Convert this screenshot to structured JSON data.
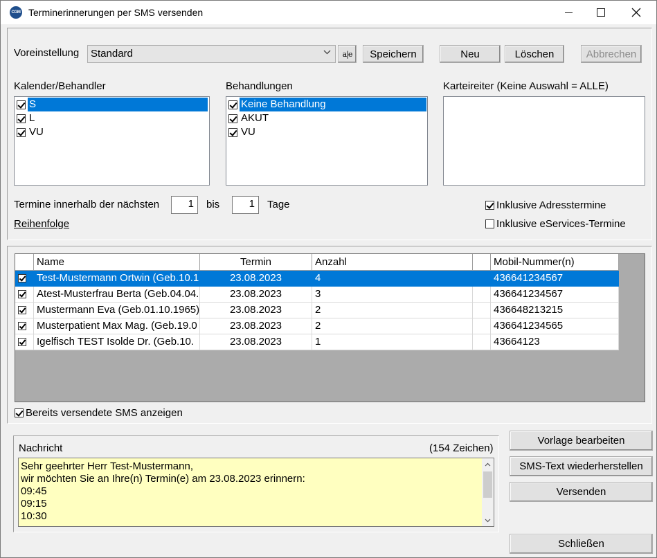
{
  "window": {
    "title": "Terminerinnerungen per SMS versenden",
    "icon_text": "CGM"
  },
  "preset": {
    "label": "Voreinstellung",
    "selected": "Standard",
    "rename_icon": "a|e",
    "save_label": "Speichern",
    "new_label": "Neu",
    "delete_label": "Löschen",
    "cancel_label": "Abbrechen"
  },
  "calendars": {
    "label": "Kalender/Behandler",
    "items": [
      {
        "label": "S",
        "checked": true,
        "selected": true
      },
      {
        "label": "L",
        "checked": true,
        "selected": false
      },
      {
        "label": "VU",
        "checked": true,
        "selected": false
      }
    ]
  },
  "treatments": {
    "label": "Behandlungen",
    "items": [
      {
        "label": "Keine Behandlung",
        "checked": true,
        "selected": true
      },
      {
        "label": "AKUT",
        "checked": true,
        "selected": false
      },
      {
        "label": "VU",
        "checked": true,
        "selected": false
      }
    ]
  },
  "tabs_filter": {
    "label": "Karteireiter (Keine Auswahl = ALLE)"
  },
  "range": {
    "prefix": "Termine innerhalb der nächsten",
    "from": "1",
    "between": "bis",
    "to": "1",
    "suffix": "Tage",
    "order_link": "Reihenfolge"
  },
  "options": {
    "address_appointments": "Inklusive Adresstermine",
    "eservices": "Inklusive eServices-Termine",
    "show_sent": "Bereits versendete SMS anzeigen"
  },
  "grid": {
    "headers": {
      "name": "Name",
      "date": "Termin",
      "count": "Anzahl",
      "extra": "",
      "mobile": "Mobil-Nummer(n)"
    },
    "rows": [
      {
        "name": "Test-Mustermann Ortwin (Geb.10.1",
        "date": "23.08.2023",
        "count": "4",
        "mobile": "436641234567",
        "selected": true
      },
      {
        "name": "Atest-Musterfrau Berta (Geb.04.04.",
        "date": "23.08.2023",
        "count": "3",
        "mobile": "436641234567",
        "selected": false
      },
      {
        "name": "Mustermann Eva (Geb.01.10.1965)",
        "date": "23.08.2023",
        "count": "2",
        "mobile": "436648213215",
        "selected": false
      },
      {
        "name": "Musterpatient Max Mag. (Geb.19.0",
        "date": "23.08.2023",
        "count": "2",
        "mobile": "436641234565",
        "selected": false
      },
      {
        "name": "Igelfisch TEST Isolde Dr. (Geb.10.",
        "date": "23.08.2023",
        "count": "1",
        "mobile": "43664123",
        "selected": false
      }
    ]
  },
  "message": {
    "label": "Nachricht",
    "char_count": "(154 Zeichen)",
    "lines": [
      "Sehr geehrter Herr Test-Mustermann,",
      "wir möchten Sie an Ihre(n) Termin(e) am 23.08.2023 erinnern:",
      "09:45",
      "09:15",
      "10:30"
    ]
  },
  "actions": {
    "edit_template": "Vorlage bearbeiten",
    "restore_text": "SMS-Text wiederherstellen",
    "send": "Versenden",
    "close": "Schließen"
  }
}
